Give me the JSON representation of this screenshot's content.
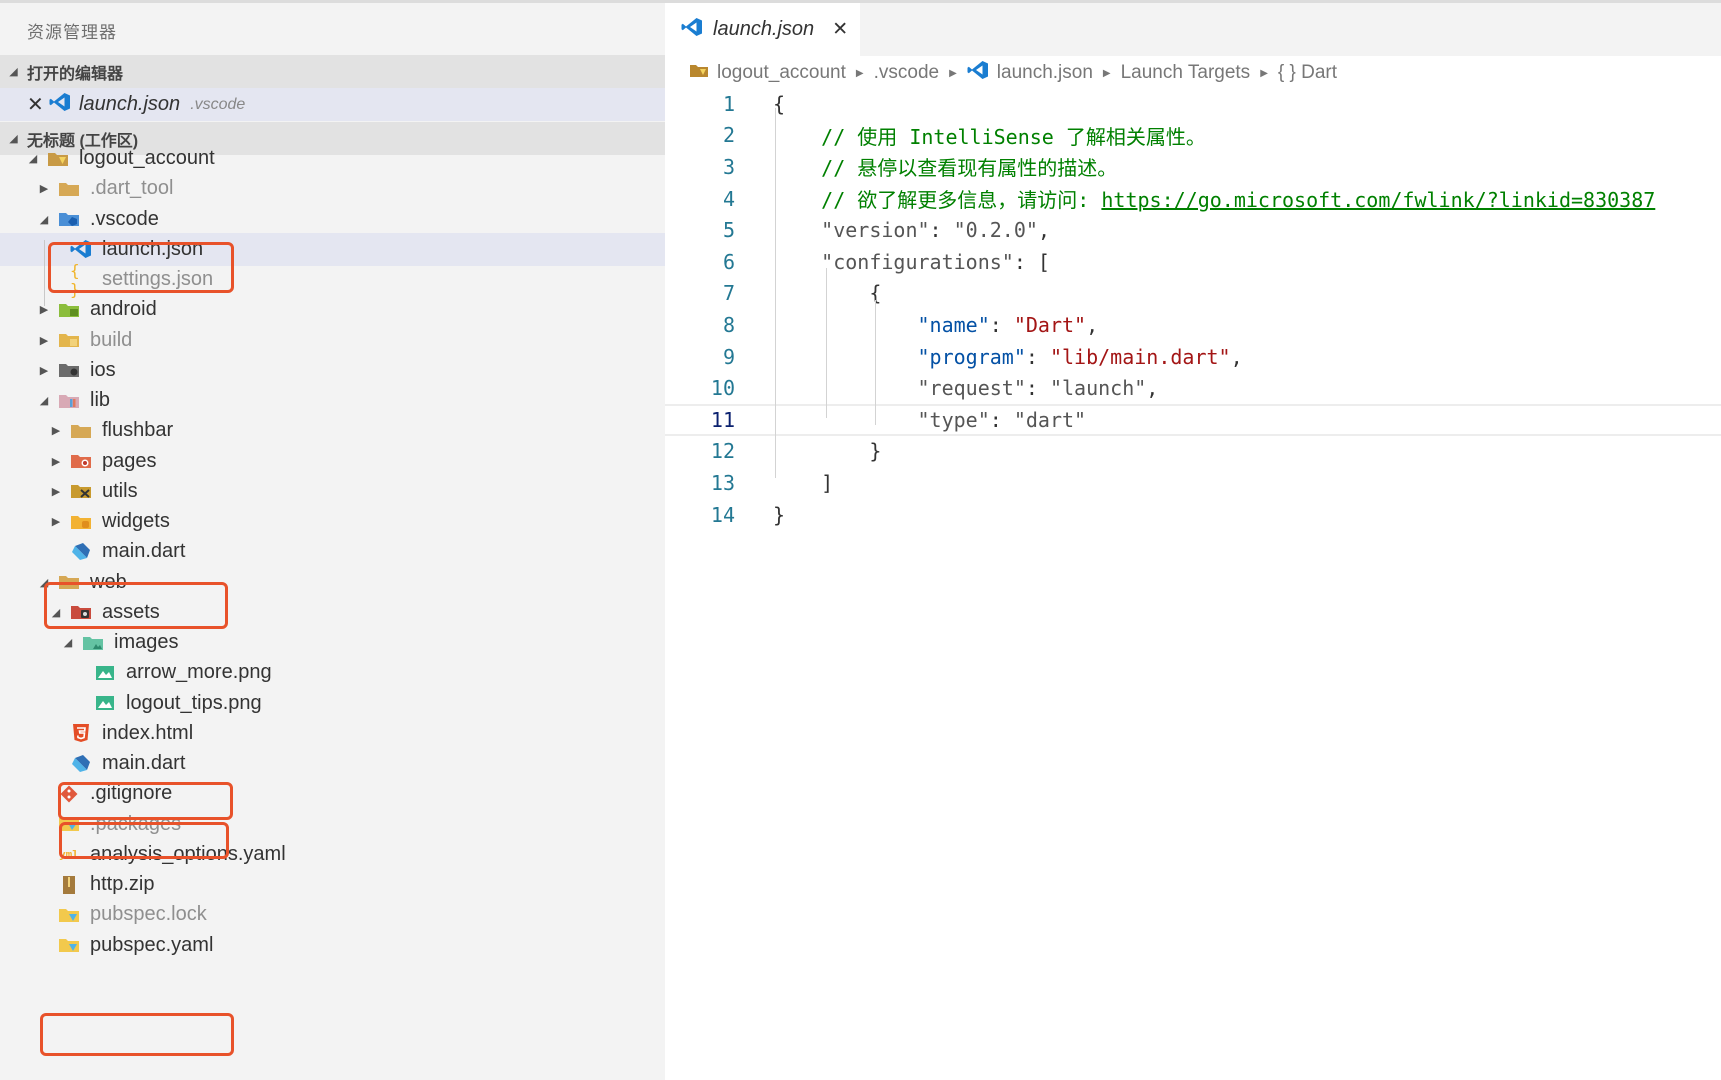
{
  "sidebar": {
    "title": "资源管理器",
    "open_editors_header": "打开的编辑器",
    "open_editor": {
      "name": "launch.json",
      "path": ".vscode"
    },
    "workspace_header": "无标题 (工作区)",
    "tree": [
      {
        "label": "logout_account",
        "icon": "folder-root-icon"
      },
      {
        "label": ".dart_tool",
        "icon": "folder-icon"
      },
      {
        "label": ".vscode",
        "icon": "folder-vscode-icon"
      },
      {
        "label": "launch.json",
        "icon": "vscode-icon"
      },
      {
        "label": "settings.json",
        "icon": "json-braces-icon"
      },
      {
        "label": "android",
        "icon": "folder-android-icon"
      },
      {
        "label": "build",
        "icon": "folder-build-icon"
      },
      {
        "label": "ios",
        "icon": "folder-ios-icon"
      },
      {
        "label": "lib",
        "icon": "folder-lib-icon"
      },
      {
        "label": "flushbar",
        "icon": "folder-icon"
      },
      {
        "label": "pages",
        "icon": "folder-pages-icon"
      },
      {
        "label": "utils",
        "icon": "folder-utils-icon"
      },
      {
        "label": "widgets",
        "icon": "folder-widgets-icon"
      },
      {
        "label": "main.dart",
        "icon": "dart-icon"
      },
      {
        "label": "web",
        "icon": "folder-icon"
      },
      {
        "label": "assets",
        "icon": "folder-assets-icon"
      },
      {
        "label": "images",
        "icon": "folder-images-icon"
      },
      {
        "label": "arrow_more.png",
        "icon": "image-icon"
      },
      {
        "label": "logout_tips.png",
        "icon": "image-icon"
      },
      {
        "label": "index.html",
        "icon": "html5-icon"
      },
      {
        "label": "main.dart",
        "icon": "dart-icon"
      },
      {
        "label": ".gitignore",
        "icon": "git-icon"
      },
      {
        "label": ".packages",
        "icon": "packages-icon"
      },
      {
        "label": "analysis_options.yaml",
        "icon": "yaml-icon"
      },
      {
        "label": "http.zip",
        "icon": "zip-icon"
      },
      {
        "label": "pubspec.lock",
        "icon": "pubspec-icon"
      },
      {
        "label": "pubspec.yaml",
        "icon": "pubspec-icon"
      }
    ]
  },
  "editor": {
    "tab": {
      "name": "launch.json"
    },
    "breadcrumb": [
      "logout_account",
      ".vscode",
      "launch.json",
      "Launch Targets",
      "{ } Dart"
    ],
    "lines": [
      {
        "n": "1"
      },
      {
        "n": "2"
      },
      {
        "n": "3"
      },
      {
        "n": "4"
      },
      {
        "n": "5"
      },
      {
        "n": "6"
      },
      {
        "n": "7"
      },
      {
        "n": "8"
      },
      {
        "n": "9"
      },
      {
        "n": "10"
      },
      {
        "n": "11"
      },
      {
        "n": "12"
      },
      {
        "n": "13"
      },
      {
        "n": "14"
      }
    ],
    "code": {
      "open_brace": "{",
      "comment1": "// 使用 IntelliSense 了解相关属性。",
      "comment2": "// 悬停以查看现有属性的描述。",
      "comment3_prefix": "// 欲了解更多信息，请访问: ",
      "comment3_link": "https://go.microsoft.com/fwlink/?linkid=830387",
      "version_key": "\"version\"",
      "version_val": "\"0.2.0\"",
      "configurations_key": "\"configurations\"",
      "open_bracket": "[",
      "inner_open": "{",
      "name_key": "\"name\"",
      "name_val": "\"Dart\"",
      "program_key": "\"program\"",
      "program_val": "\"lib/main.dart\"",
      "request_key": "\"request\"",
      "request_val": "\"launch\"",
      "type_key": "\"type\"",
      "type_val": "\"dart\"",
      "inner_close": "}",
      "close_bracket": "]",
      "close_brace": "}"
    }
  },
  "colors": {
    "highlight_box": "#e8522a",
    "comment": "#008000",
    "json_key": "#0451a5",
    "json_string": "#a31515",
    "line_number": "#237893"
  }
}
